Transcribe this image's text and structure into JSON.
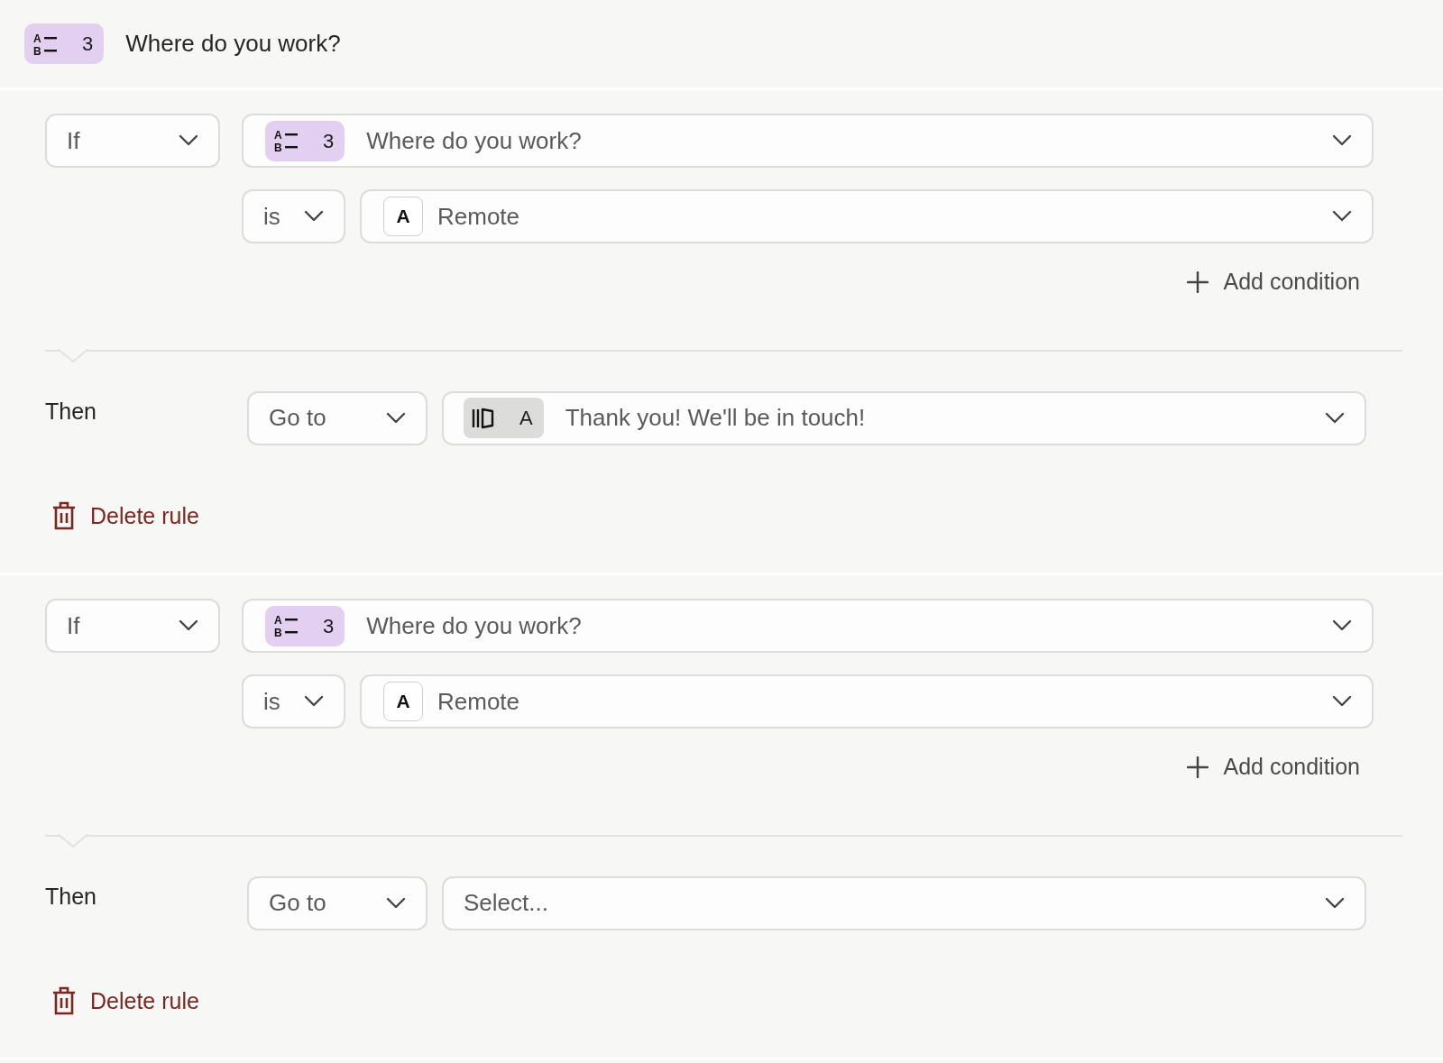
{
  "header": {
    "icon_letters": [
      "A",
      "B"
    ],
    "number": "3",
    "title": "Where do you work?"
  },
  "rules": [
    {
      "operator": "If",
      "question": {
        "icon_letters": [
          "A",
          "B"
        ],
        "number": "3",
        "label": "Where do you work?"
      },
      "comparator": "is",
      "answer": {
        "letter": "A",
        "label": "Remote"
      },
      "add_condition": "Add condition",
      "then_label": "Then",
      "action": "Go to",
      "target": {
        "kind": "screen",
        "letter": "A",
        "label": "Thank you! We'll be in touch!"
      },
      "delete": "Delete rule"
    },
    {
      "operator": "If",
      "question": {
        "icon_letters": [
          "A",
          "B"
        ],
        "number": "3",
        "label": "Where do you work?"
      },
      "comparator": "is",
      "answer": {
        "letter": "A",
        "label": "Remote"
      },
      "add_condition": "Add condition",
      "then_label": "Then",
      "action": "Go to",
      "target": {
        "kind": "placeholder",
        "placeholder": "Select..."
      },
      "delete": "Delete rule"
    }
  ]
}
